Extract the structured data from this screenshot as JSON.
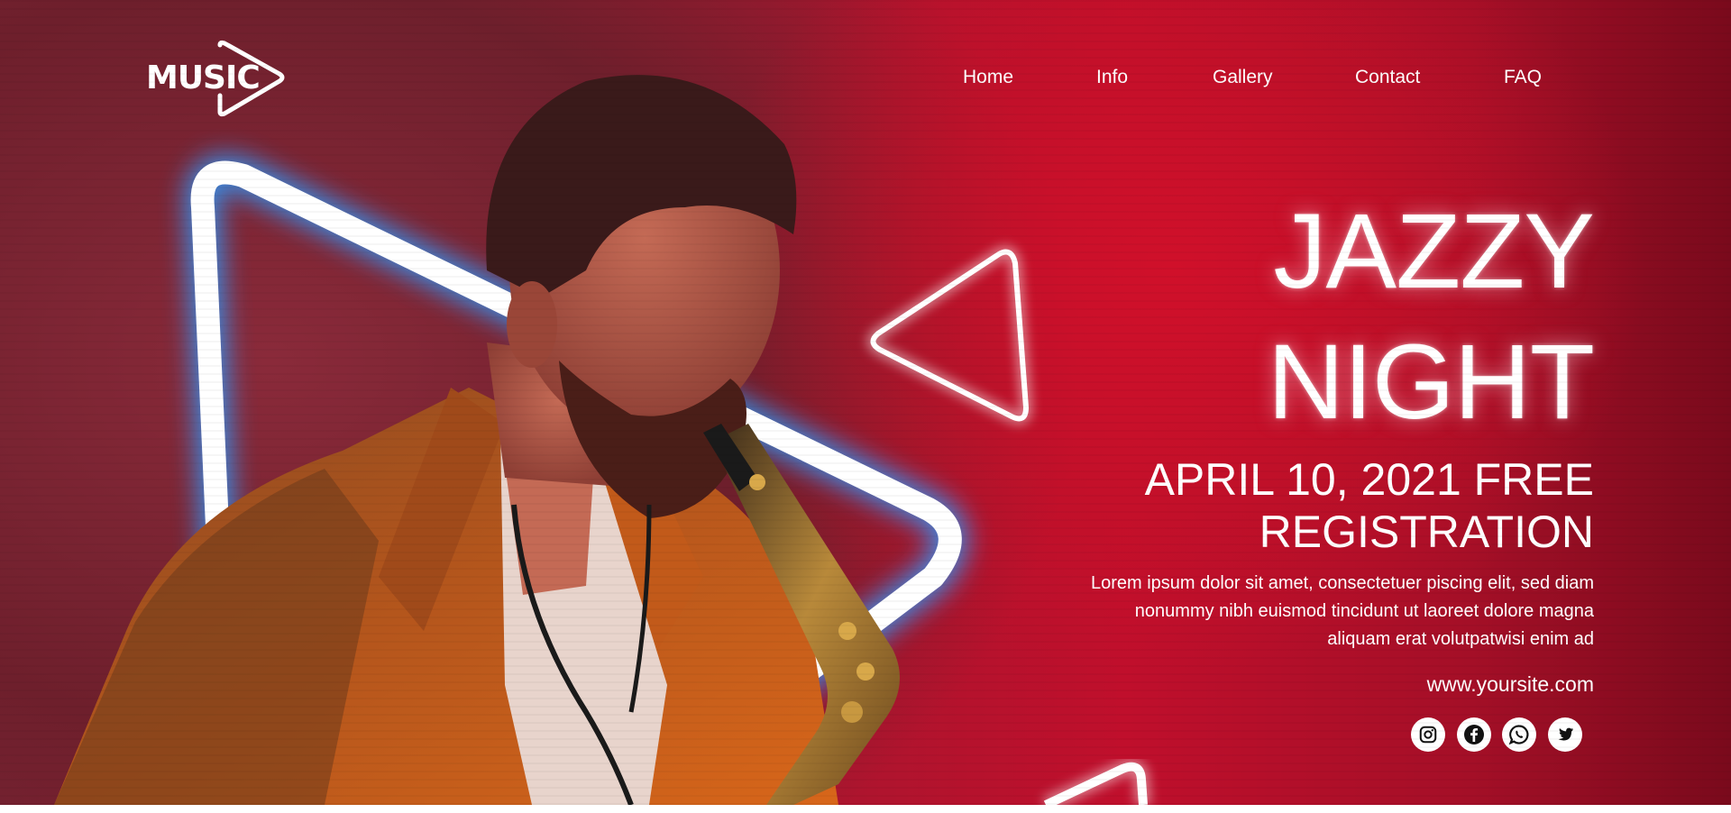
{
  "brand": {
    "name": "MUSIC"
  },
  "nav": {
    "items": [
      {
        "label": "Home"
      },
      {
        "label": "Info"
      },
      {
        "label": "Gallery"
      },
      {
        "label": "Contact"
      },
      {
        "label": "FAQ"
      }
    ]
  },
  "hero": {
    "title_line1": "JAZZY",
    "title_line2": "NIGHT",
    "subtitle_line1": "APRIL 10, 2021 FREE",
    "subtitle_line2": "REGISTRATION",
    "body": "Lorem ipsum dolor sit amet, consectetuer piscing elit, sed diam nonummy nibh euismod tincidunt ut laoreet dolore magna aliquam erat volutpatwisi enim ad",
    "website": "www.yoursite.com"
  },
  "social": [
    {
      "icon": "instagram-icon"
    },
    {
      "icon": "facebook-icon"
    },
    {
      "icon": "whatsapp-icon"
    },
    {
      "icon": "twitter-icon"
    }
  ],
  "colors": {
    "background_red": "#c00f2c",
    "neon_blue": "#2f9bff",
    "text": "#ffffff",
    "icon_dark": "#111111"
  }
}
